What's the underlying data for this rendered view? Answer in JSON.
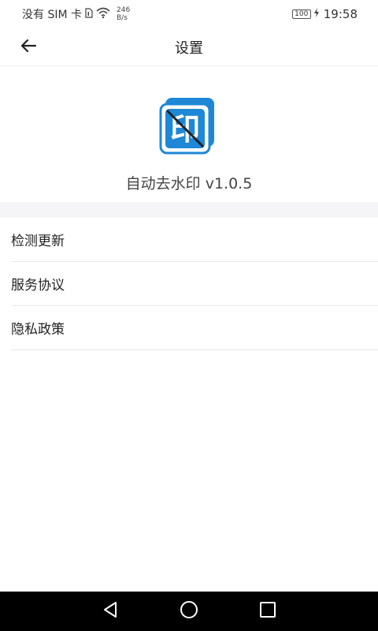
{
  "status_bar": {
    "carrier": "没有 SIM 卡",
    "speed_value": "246",
    "speed_unit": "B/s",
    "battery_level": "100",
    "time": "19:58"
  },
  "header": {
    "title": "设置"
  },
  "app": {
    "logo_glyph": "印",
    "name": "自动去水印 v1.0.5",
    "accent_color": "#1e88d6"
  },
  "menu": {
    "items": [
      {
        "label": "检测更新"
      },
      {
        "label": "服务协议"
      },
      {
        "label": "隐私政策"
      }
    ]
  },
  "icons": {
    "back": "arrow-left-icon",
    "nav_back": "triangle-back-icon",
    "nav_home": "circle-home-icon",
    "nav_recents": "square-recents-icon"
  }
}
